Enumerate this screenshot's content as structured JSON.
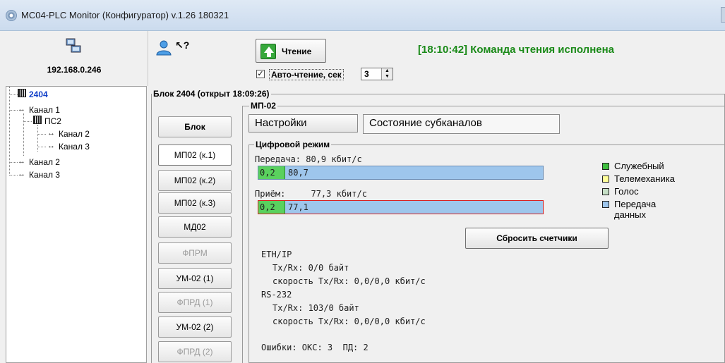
{
  "window": {
    "title": "МС04-PLC Monitor (Конфигуратор) v.1.26 180321"
  },
  "left": {
    "ip": "192.168.0.246",
    "tree": {
      "root": "2404",
      "items": [
        "Канал 1",
        "ПС2",
        "Канал 2",
        "Канал 3",
        "Канал 2",
        "Канал 3"
      ]
    }
  },
  "toolbar": {
    "read_button": "Чтение",
    "status": "[18:10:42] Команда чтения исполнена",
    "auto_read_label": "Авто-чтение, сек",
    "auto_read_checked": "✓",
    "auto_read_value": "3"
  },
  "block": {
    "title": "Блок 2404 (открыт 18:09:26)",
    "side_buttons": [
      "Блок",
      "МП02 (к.1)",
      "МП02 (к.2)",
      "МП02 (к.3)",
      "МД02",
      "ФПРМ",
      "УМ-02 (1)",
      "ФПРД (1)",
      "УМ-02 (2)",
      "ФПРД (2)"
    ]
  },
  "mp": {
    "title": "МП-02",
    "tabs": [
      "Настройки",
      "Состояние субканалов"
    ],
    "digital_title": "Цифровой режим",
    "tx_label": "Передача: 80,9 кбит/с",
    "tx_green": "0,2",
    "tx_blue": "80,7",
    "rx_label": "Приём:     77,3 кбит/с",
    "rx_green": "0,2",
    "rx_blue": "77,1",
    "legend": [
      {
        "label": "Служебный",
        "color": "#3fbf3f"
      },
      {
        "label": "Телемеханика",
        "color": "#ffff99"
      },
      {
        "label": "Голос",
        "color": "#c6dfc6"
      },
      {
        "label": "Передача данных",
        "color": "#9ec6ec"
      }
    ],
    "reset_button": "Сбросить счетчики",
    "stats": {
      "eth_title": "ETH/IP",
      "eth_txrx": "Tx/Rx: 0/0 байт",
      "eth_speed": "скорость Tx/Rx: 0,0/0,0 кбит/с",
      "rs_title": "RS-232",
      "rs_txrx": "Tx/Rx: 103/0 байт",
      "rs_speed": "скорость Tx/Rx: 0,0/0,0 кбит/с",
      "errors": "Ошибки: ОКС: 3  ПД: 2"
    }
  }
}
